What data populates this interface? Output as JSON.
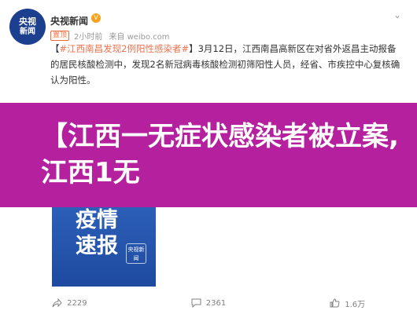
{
  "post": {
    "account_name": "央视新闻",
    "avatar_text": "央视",
    "avatar_subtext": "新闻",
    "verified_symbol": "V",
    "source_tag": "置顶",
    "time": "2小时前",
    "source": "来自 weibo.com",
    "topic": "#江西南昌发现2例阳性感染者#",
    "body": "】3月12日，江西南昌高新区在对省外返昌主动报备的居民核酸检测中，发现2名新冠病毒核酸检测初筛阳性人员，经省、市疾控中心复核确认为阳性。",
    "body_prefix": "【"
  },
  "overlay": {
    "text": "【江西一无症状感染者被立案,江西1无"
  },
  "media": {
    "title": "疫情速报",
    "logo_text": "央视新闻"
  },
  "actions": {
    "share_count": "2229",
    "comment_count": "2361",
    "like_count": "1.6万"
  },
  "colors": {
    "overlay_bg": "#b5209f",
    "topic": "#eb7350",
    "media_bg": "#2c5fb8"
  }
}
